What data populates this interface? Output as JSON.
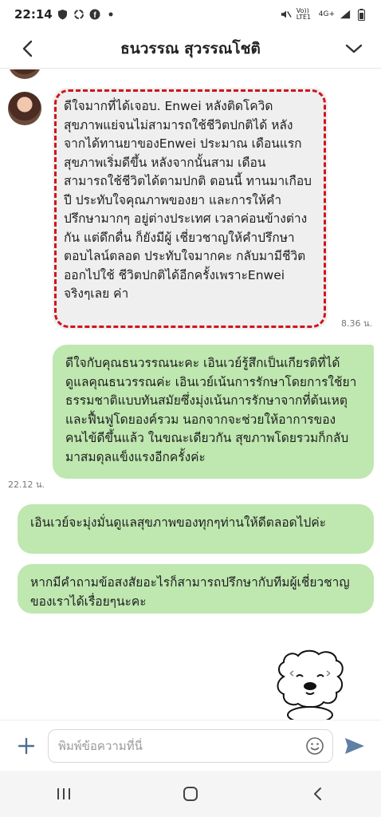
{
  "status_bar": {
    "time": "22:14",
    "network": "Vo)) LTE1",
    "signal": "4G+"
  },
  "header": {
    "title": "ธนวรรณ สุวรรณโชติ",
    "back_icon": "chevron-left-icon",
    "menu_icon": "chevron-down-icon"
  },
  "messages": [
    {
      "direction": "incoming",
      "text": "ดีใจมากที่ได้เจอบ. Enwei หลังติดโควิด สุขภาพแย่จนไม่สามารถใช้ชีวิตปกติได้ หลังจากได้ทานยาของEnwei ประมาณ เดือนแรกสุขภาพเริ่มดีขึ้น หลังจากนั้นสาม เดือน สามารถใช้ชีวิตได้ตามปกติ ตอนนี้ ทานมาเกือบปี ประทับใจคุณภาพของยา และการให้คำปรึกษามากๆ อยู่ต่างประเทศ เวลาค่อนข้างต่างกัน แต่ดึกดื่น ก็ยังมีผู้ เชี่ยวชาญให้คำปรึกษาตอบไลน์ตลอด ประทับใจมากคะ กลับมามีชีวิต ออกไปใช้ ชีวิตปกติได้อีกครั้งเพราะEnwei จริงๆเลย ค่า",
      "time": "8.36 น.",
      "highlight_color": "#d0141c"
    },
    {
      "direction": "outgoing",
      "text": "ดีใจกับคุณธนวรรณนะคะ เอินเวย์รู้สึกเป็นเกียรติที่ได้ดูแลคุณธนวรรณค่ะ เอินเวย์เน้นการรักษาโดยการใช้ยาธรรมชาติแบบทันสมัยซึ่งมุ่งเน้นการรักษาจากที่ต้นเหตุและฟื้นฟูโดยองค์รวม นอกจากจะช่วยให้อาการของคนไข้ดีขึ้นแล้ว ในขณะเดียวกัน สุขภาพโดยรวมก็กลับมาสมดุลแข็งแรงอีกครั้งค่ะ",
      "time": "22.12 น."
    },
    {
      "direction": "outgoing",
      "text": "เอินเวย์จะมุ่งมั่นดูแลสุขภาพของทุกๆท่านให้ดีตลอดไปค่ะ"
    },
    {
      "direction": "outgoing",
      "text": "หากมีคำถามข้อสงสัยอะไรก็สามารถปรึกษากับทีมผู้เชี่ยวชาญของเราได้เรื่อยๆนะคะ"
    }
  ],
  "composer": {
    "placeholder": "พิมพ์ข้อความที่นี่",
    "plus_icon": "plus-icon",
    "emoji_icon": "emoji-icon",
    "send_icon": "send-icon"
  },
  "colors": {
    "outgoing_bubble": "#bfe7b0",
    "incoming_bubble": "#efefef",
    "send_icon": "#5f7fa6"
  }
}
